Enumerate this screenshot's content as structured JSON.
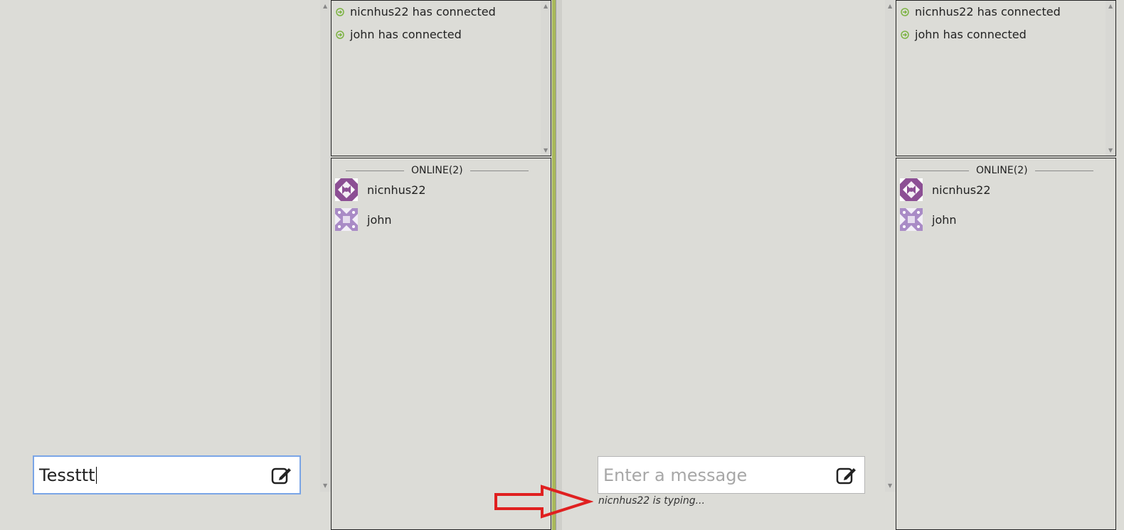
{
  "left_client": {
    "input": {
      "value": "Tessttt",
      "placeholder": "Enter a message"
    },
    "log": [
      {
        "text": "nicnhus22 has connected"
      },
      {
        "text": "john has connected"
      }
    ],
    "online_header": "ONLINE(2)",
    "users": [
      {
        "name": "nicnhus22",
        "avatar": "identicon-dark-purple"
      },
      {
        "name": "john",
        "avatar": "identicon-light-purple"
      }
    ]
  },
  "right_client": {
    "input": {
      "value": "",
      "placeholder": "Enter a message"
    },
    "typing_indicator": "nicnhus22 is typing...",
    "log": [
      {
        "text": "nicnhus22 has connected"
      },
      {
        "text": "john has connected"
      }
    ],
    "online_header": "ONLINE(2)",
    "users": [
      {
        "name": "nicnhus22",
        "avatar": "identicon-dark-purple"
      },
      {
        "name": "john",
        "avatar": "identicon-light-purple"
      }
    ]
  },
  "colors": {
    "background": "#dcdcd7",
    "connect_icon": "#7cb342",
    "avatar_dark": "#8c4f94",
    "avatar_light": "#a98bc6",
    "arrow": "#e02020",
    "divider": "#a8b85a"
  },
  "icons": {
    "connect": "arrow-right-circle-icon",
    "compose": "pencil-square-icon",
    "annotation": "red-arrow"
  }
}
